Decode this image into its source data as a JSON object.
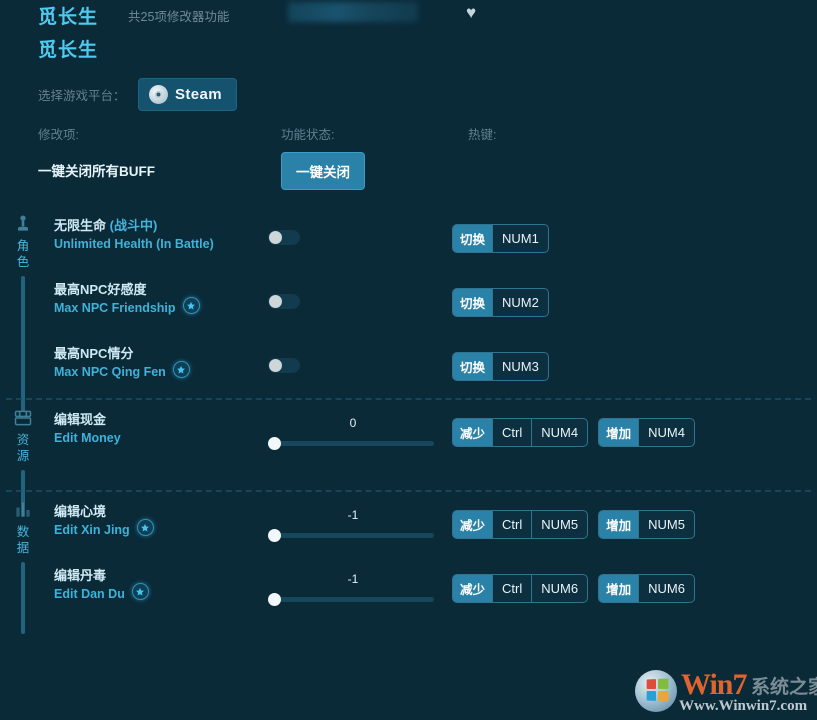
{
  "header": {
    "game_title": "觅长生",
    "game_subtitle": "觅长生",
    "feature_count": "共25项修改器功能",
    "heart_icon": "favorite-heart-icon"
  },
  "platform": {
    "label": "选择游戏平台：",
    "selected": "Steam",
    "icon": "steam-logo-icon"
  },
  "columns": {
    "modification": "修改项:",
    "status": "功能状态:",
    "hotkey": "热键:"
  },
  "global_off": {
    "label": "一键关闭所有BUFF",
    "button": "一键关闭"
  },
  "sections": [
    {
      "id": "character",
      "rail_text": "角色",
      "rail_icon": "person-icon",
      "rows": [
        {
          "cn": "无限生命 (战斗中)",
          "en": "Unlimited Health (In Battle)",
          "star": false,
          "control": "toggle",
          "toggle_on": false,
          "hotkeys": [
            {
              "action": "切换",
              "key": "NUM1"
            }
          ]
        },
        {
          "cn": "最高NPC好感度",
          "en": "Max NPC Friendship",
          "star": true,
          "control": "toggle",
          "toggle_on": false,
          "hotkeys": [
            {
              "action": "切换",
              "key": "NUM2"
            }
          ]
        },
        {
          "cn": "最高NPC情分",
          "en": "Max NPC Qing Fen",
          "star": true,
          "control": "toggle",
          "toggle_on": false,
          "hotkeys": [
            {
              "action": "切换",
              "key": "NUM3"
            }
          ]
        }
      ]
    },
    {
      "id": "resources",
      "rail_text": "资源",
      "rail_icon": "treasure-chest-icon",
      "rows": [
        {
          "cn": "编辑现金",
          "en": "Edit Money",
          "star": false,
          "control": "slider",
          "value": "0",
          "slider_percent": 0,
          "hotkeys": [
            {
              "action": "减少",
              "key": "Ctrl",
              "key2": "NUM4"
            },
            {
              "action": "增加",
              "key": "NUM4"
            }
          ]
        }
      ]
    },
    {
      "id": "data",
      "rail_text": "数据",
      "rail_icon": "bar-chart-icon",
      "rows": [
        {
          "cn": "编辑心境",
          "en": "Edit Xin Jing",
          "star": true,
          "control": "slider",
          "value": "-1",
          "slider_percent": 0,
          "hotkeys": [
            {
              "action": "减少",
              "key": "Ctrl",
              "key2": "NUM5"
            },
            {
              "action": "增加",
              "key": "NUM5"
            }
          ]
        },
        {
          "cn": "编辑丹毒",
          "en": "Edit Dan Du",
          "star": true,
          "control": "slider",
          "value": "-1",
          "slider_percent": 0,
          "hotkeys": [
            {
              "action": "减少",
              "key": "Ctrl",
              "key2": "NUM6"
            },
            {
              "action": "增加",
              "key": "NUM6"
            }
          ]
        }
      ]
    }
  ],
  "watermark": {
    "win": "Win",
    "seven": "7",
    "cn": "系统之家",
    "url": "Www.Winwin7.com"
  },
  "colors": {
    "background": "#0a2a38",
    "accent": "#2b82a8",
    "title": "#4fc9f0",
    "label_en": "#3fb2da"
  }
}
